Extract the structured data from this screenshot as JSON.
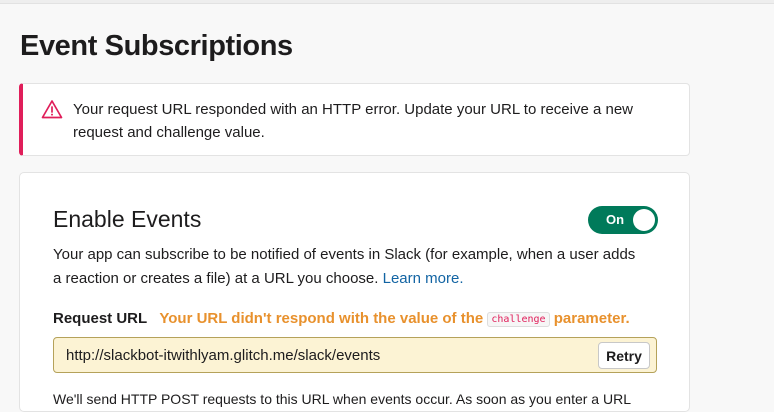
{
  "page": {
    "title": "Event Subscriptions"
  },
  "alert": {
    "icon": "warning-icon",
    "accent_color": "#e01e5a",
    "message": "Your request URL responded with an HTTP error. Update your URL to receive a new request and challenge value."
  },
  "events": {
    "title": "Enable Events",
    "toggle_label": "On",
    "toggle_color": "#007a5a",
    "description": "Your app can subscribe to be notified of events in Slack (for example, when a user adds a reaction or creates a file) at a URL you choose.",
    "learn_more": "Learn more.",
    "request_url_label": "Request URL",
    "error_prefix": "Your URL didn't respond with the value of the",
    "error_code": "challenge",
    "error_suffix": "parameter.",
    "url_value": "http://slackbot-itwithlyam.glitch.me/slack/events",
    "retry_label": "Retry",
    "footer_text": "We'll send HTTP POST requests to this URL when events occur. As soon as you enter a URL"
  }
}
